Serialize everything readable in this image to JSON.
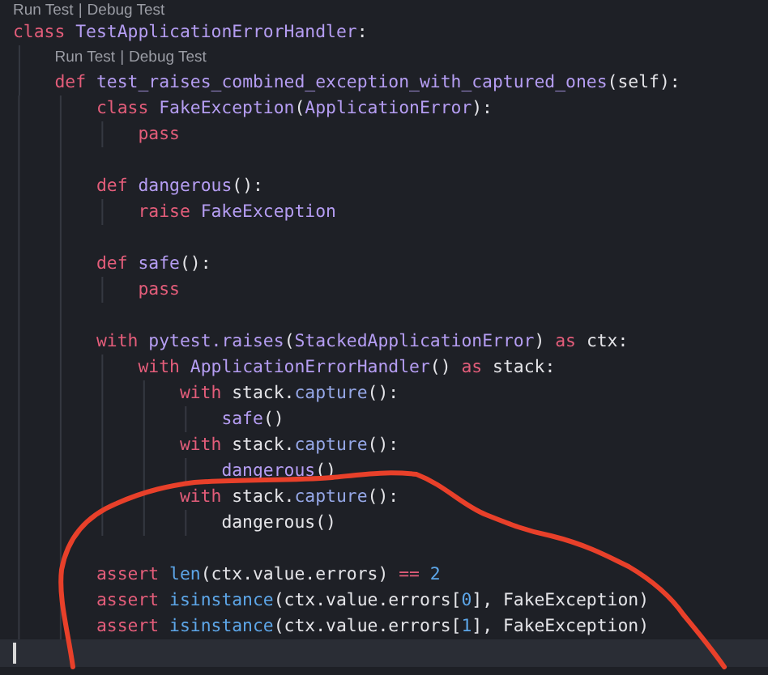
{
  "editor": {
    "lines": [
      {
        "kind": "code",
        "lens": {
          "links": [
            "Run Test",
            "Debug Test"
          ],
          "separator": "|"
        },
        "tokens": [
          {
            "kind": "kw",
            "text": "class "
          },
          {
            "kind": "cls",
            "text": "TestApplicationErrorHandler"
          },
          {
            "kind": "plain",
            "text": ":"
          }
        ],
        "children": [
          {
            "kind": "code",
            "lens": {
              "links": [
                "Run Test",
                "Debug Test"
              ],
              "separator": "|"
            },
            "tokens": [
              {
                "kind": "kw",
                "text": "def "
              },
              {
                "kind": "cls",
                "text": "test_raises_combined_exception_with_captured_ones"
              },
              {
                "kind": "plain",
                "text": "(self):"
              }
            ],
            "children": [
              {
                "kind": "code",
                "tokens": [
                  {
                    "kind": "kw",
                    "text": "class "
                  },
                  {
                    "kind": "cls",
                    "text": "FakeException"
                  },
                  {
                    "kind": "plain",
                    "text": "("
                  },
                  {
                    "kind": "cls",
                    "text": "ApplicationError"
                  },
                  {
                    "kind": "plain",
                    "text": "):"
                  }
                ],
                "children": [
                  {
                    "kind": "code",
                    "tokens": [
                      {
                        "kind": "kw",
                        "text": "pass"
                      }
                    ]
                  }
                ]
              },
              {
                "kind": "blank"
              },
              {
                "kind": "code",
                "tokens": [
                  {
                    "kind": "kw",
                    "text": "def "
                  },
                  {
                    "kind": "cls",
                    "text": "dangerous"
                  },
                  {
                    "kind": "plain",
                    "text": "():"
                  }
                ],
                "children": [
                  {
                    "kind": "code",
                    "tokens": [
                      {
                        "kind": "kw",
                        "text": "raise "
                      },
                      {
                        "kind": "cls",
                        "text": "FakeException"
                      }
                    ]
                  }
                ]
              },
              {
                "kind": "blank"
              },
              {
                "kind": "code",
                "tokens": [
                  {
                    "kind": "kw",
                    "text": "def "
                  },
                  {
                    "kind": "cls",
                    "text": "safe"
                  },
                  {
                    "kind": "plain",
                    "text": "():"
                  }
                ],
                "children": [
                  {
                    "kind": "code",
                    "tokens": [
                      {
                        "kind": "kw",
                        "text": "pass"
                      }
                    ]
                  }
                ]
              },
              {
                "kind": "blank"
              },
              {
                "kind": "code",
                "tokens": [
                  {
                    "kind": "kw",
                    "text": "with "
                  },
                  {
                    "kind": "cls",
                    "text": "pytest.raises"
                  },
                  {
                    "kind": "plain",
                    "text": "("
                  },
                  {
                    "kind": "cls",
                    "text": "StackedApplicationError"
                  },
                  {
                    "kind": "plain",
                    "text": ") "
                  },
                  {
                    "kind": "kw",
                    "text": "as "
                  },
                  {
                    "kind": "plain",
                    "text": "ctx:"
                  }
                ],
                "children": [
                  {
                    "kind": "code",
                    "tokens": [
                      {
                        "kind": "kw",
                        "text": "with "
                      },
                      {
                        "kind": "cls",
                        "text": "ApplicationErrorHandler"
                      },
                      {
                        "kind": "plain",
                        "text": "() "
                      },
                      {
                        "kind": "kw",
                        "text": "as "
                      },
                      {
                        "kind": "plain",
                        "text": "stack:"
                      }
                    ],
                    "children": [
                      {
                        "kind": "code",
                        "tokens": [
                          {
                            "kind": "kw",
                            "text": "with "
                          },
                          {
                            "kind": "plain",
                            "text": "stack."
                          },
                          {
                            "kind": "attr",
                            "text": "capture"
                          },
                          {
                            "kind": "plain",
                            "text": "():"
                          }
                        ],
                        "children": [
                          {
                            "kind": "code",
                            "tokens": [
                              {
                                "kind": "cls",
                                "text": "safe"
                              },
                              {
                                "kind": "plain",
                                "text": "()"
                              }
                            ]
                          }
                        ]
                      },
                      {
                        "kind": "code",
                        "tokens": [
                          {
                            "kind": "kw",
                            "text": "with "
                          },
                          {
                            "kind": "plain",
                            "text": "stack."
                          },
                          {
                            "kind": "attr",
                            "text": "capture"
                          },
                          {
                            "kind": "plain",
                            "text": "():"
                          }
                        ],
                        "children": [
                          {
                            "kind": "code",
                            "tokens": [
                              {
                                "kind": "cls",
                                "text": "dangerous"
                              },
                              {
                                "kind": "plain",
                                "text": "()"
                              }
                            ]
                          }
                        ]
                      },
                      {
                        "kind": "code",
                        "tokens": [
                          {
                            "kind": "kw",
                            "text": "with "
                          },
                          {
                            "kind": "plain",
                            "text": "stack."
                          },
                          {
                            "kind": "attr",
                            "text": "capture"
                          },
                          {
                            "kind": "plain",
                            "text": "():"
                          }
                        ],
                        "children": [
                          {
                            "kind": "code",
                            "tokens": [
                              {
                                "kind": "plain",
                                "text": "dangerous()"
                              }
                            ]
                          }
                        ]
                      }
                    ]
                  }
                ]
              },
              {
                "kind": "blank"
              },
              {
                "kind": "code",
                "tokens": [
                  {
                    "kind": "kw",
                    "text": "assert "
                  },
                  {
                    "kind": "builtin",
                    "text": "len"
                  },
                  {
                    "kind": "plain",
                    "text": "(ctx.value.errors) "
                  },
                  {
                    "kind": "kw",
                    "text": "== "
                  },
                  {
                    "kind": "num",
                    "text": "2"
                  }
                ]
              },
              {
                "kind": "code",
                "tokens": [
                  {
                    "kind": "kw",
                    "text": "assert "
                  },
                  {
                    "kind": "builtin",
                    "text": "isinstance"
                  },
                  {
                    "kind": "plain",
                    "text": "(ctx.value.errors["
                  },
                  {
                    "kind": "num",
                    "text": "0"
                  },
                  {
                    "kind": "plain",
                    "text": "], FakeException)"
                  }
                ]
              },
              {
                "kind": "code",
                "tokens": [
                  {
                    "kind": "kw",
                    "text": "assert "
                  },
                  {
                    "kind": "builtin",
                    "text": "isinstance"
                  },
                  {
                    "kind": "plain",
                    "text": "(ctx.value.errors["
                  },
                  {
                    "kind": "num",
                    "text": "1"
                  },
                  {
                    "kind": "plain",
                    "text": "], FakeException)"
                  }
                ]
              }
            ]
          }
        ]
      },
      {
        "kind": "cursor"
      }
    ]
  },
  "annotation": {
    "kind": "freehand-stroke"
  }
}
